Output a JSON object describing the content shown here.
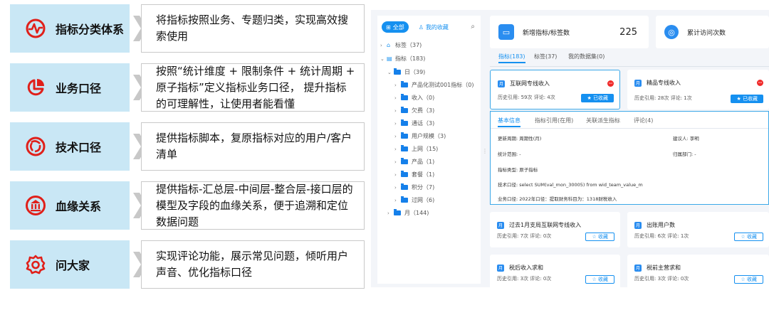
{
  "features": [
    {
      "title": "指标分类体系",
      "desc": "将指标按照业务、专题归类，实现高效搜索使用",
      "icon": "pulse-icon"
    },
    {
      "title": "业务口径",
      "desc": "按照“统计维度 + 限制条件 + 统计周期 + 原子指标”定义指标业务口径， 提升指标的可理解性，让使用者能看懂",
      "icon": "pie-chart-icon"
    },
    {
      "title": "技术口径",
      "desc": "提供指标脚本，复原指标对应的用户/客户清单",
      "icon": "aperture-icon"
    },
    {
      "title": "血缘关系",
      "desc": "提供指标-汇总层-中间层-整合层-接口层的模型及字段的血缘关系，便于追溯和定位数据问题",
      "icon": "bank-icon"
    },
    {
      "title": "问大家",
      "desc": "实现评论功能，展示常见问题，倾听用户声音、优化指标口径",
      "icon": "gear-icon"
    }
  ],
  "accent": "#1590f0",
  "app": {
    "seg_all": "全部",
    "seg_fav": "我的收藏",
    "tree": [
      {
        "label": "标签（37)",
        "level": 0,
        "caret": "›",
        "kind": "tag"
      },
      {
        "label": "指标（183)",
        "level": 0,
        "caret": "⌄",
        "kind": "metric"
      },
      {
        "label": "日（39)",
        "level": 1,
        "caret": "⌄",
        "kind": "folder"
      },
      {
        "label": "产品化测试001指标（0)",
        "level": 2,
        "caret": "›",
        "kind": "folder"
      },
      {
        "label": "收入（0)",
        "level": 2,
        "caret": "›",
        "kind": "folder"
      },
      {
        "label": "欠费（3)",
        "level": 2,
        "caret": "›",
        "kind": "folder"
      },
      {
        "label": "通话（3)",
        "level": 2,
        "caret": "›",
        "kind": "folder"
      },
      {
        "label": "用户规模（3)",
        "level": 2,
        "caret": "›",
        "kind": "folder"
      },
      {
        "label": "上网（15)",
        "level": 2,
        "caret": "›",
        "kind": "folder"
      },
      {
        "label": "产品（1)",
        "level": 2,
        "caret": "›",
        "kind": "folder"
      },
      {
        "label": "套餐（1)",
        "level": 2,
        "caret": "›",
        "kind": "folder"
      },
      {
        "label": "积分（7)",
        "level": 2,
        "caret": "›",
        "kind": "folder"
      },
      {
        "label": "过网（6)",
        "level": 2,
        "caret": "›",
        "kind": "folder"
      },
      {
        "label": "月（144)",
        "level": 1,
        "caret": "›",
        "kind": "folder"
      }
    ],
    "stat1": {
      "label": "新增指标/标签数",
      "value": "225"
    },
    "stat2": {
      "label": "累计访问次数"
    },
    "tabs": [
      "指标(183)",
      "标签(37)",
      "我的数据集(0)"
    ],
    "cards": [
      {
        "title": "互联网专线收入",
        "meta": "历史引用: 59次   评论: 4次",
        "btn": "★ 已收藏",
        "filled": true,
        "hot": true
      },
      {
        "title": "精品专线收入",
        "meta": "历史引用: 28次   评论: 1次",
        "btn": "★ 已收藏",
        "filled": true,
        "hot": true
      },
      {
        "title": "过去1月支局互联网专线收入",
        "meta": "历史引用: 7次   评论: 0次",
        "btn": "☆ 收藏",
        "filled": false
      },
      {
        "title": "出账用户数",
        "meta": "历史引用: 6次   评论: 1次",
        "btn": "☆ 收藏",
        "filled": false
      },
      {
        "title": "税后收入求和",
        "meta": "历史引用: 3次   评论: 0次",
        "btn": "☆ 收藏",
        "filled": false
      },
      {
        "title": "税前主营求和",
        "meta": "历史引用: 3次   评论: 0次",
        "btn": "☆ 收藏",
        "filled": false
      }
    ],
    "card_badge": "月",
    "hot_badge": "hot",
    "dtabs": [
      "基本信息",
      "指标引用(在用)",
      "关联派生指标",
      "评论(4)"
    ],
    "detail": {
      "l1": "更新周期: 周期性(月)",
      "r1": "建议人: 李明",
      "l2": "统计范围: -",
      "r2": "归属部门: -",
      "l3": "指标类型: 原子指标",
      "l4": "技术口径: select SUM(val_mon_30005) from wid_team_value_m",
      "l5": "业务口径: 2022年口径：提取财务科目为：1318财税收入"
    }
  }
}
